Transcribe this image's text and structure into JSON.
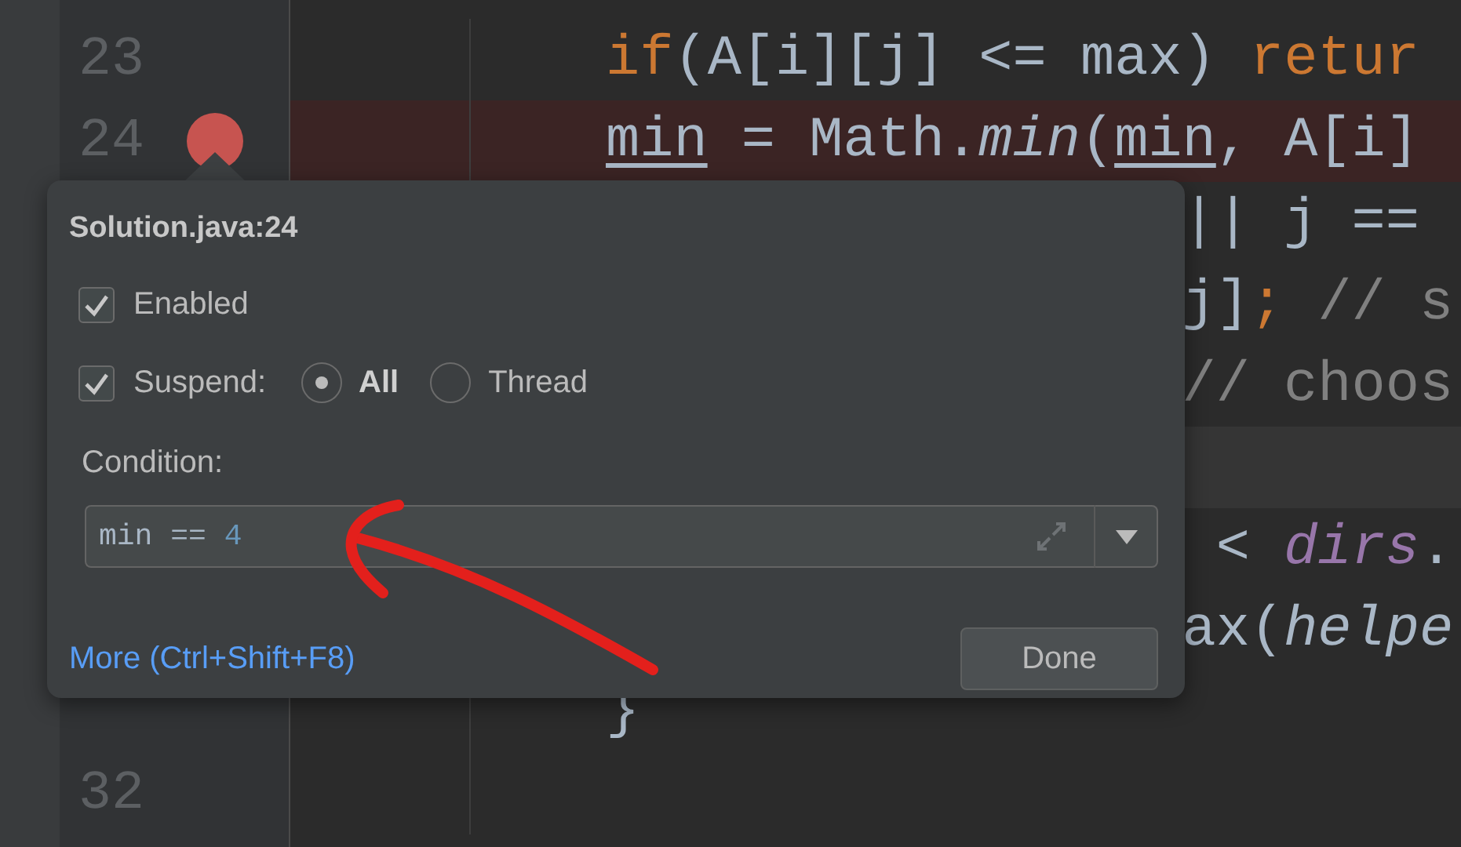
{
  "editor": {
    "lines": [
      {
        "number": "23",
        "breakpoint": false,
        "kind": "full",
        "tokens": [
          {
            "kind": "keyword",
            "text": "if"
          },
          {
            "kind": "plain",
            "text": "(A[i][j] <= max) "
          },
          {
            "kind": "keyword",
            "text": "retur"
          }
        ]
      },
      {
        "number": "24",
        "breakpoint": true,
        "kind": "full",
        "tokens": [
          {
            "kind": "reassigned",
            "text": "min"
          },
          {
            "kind": "plain",
            "text": " = Math."
          },
          {
            "kind": "method",
            "text": "min"
          },
          {
            "kind": "plain",
            "text": "("
          },
          {
            "kind": "reassigned",
            "text": "min"
          },
          {
            "kind": "plain",
            "text": ", A[i]"
          }
        ]
      },
      {
        "breakpoint": false,
        "kind": "behind_popup",
        "tokens": [
          {
            "kind": "plain",
            "text": "|| j =="
          }
        ]
      },
      {
        "breakpoint": false,
        "kind": "behind_popup",
        "tokens": [
          {
            "kind": "plain",
            "text": "j]"
          },
          {
            "kind": "keyword",
            "text": ";"
          },
          {
            "kind": "comment",
            "text": " // s"
          }
        ]
      },
      {
        "breakpoint": false,
        "kind": "behind_popup",
        "tokens": [
          {
            "kind": "comment",
            "text": "// choos"
          }
        ]
      },
      {
        "breakpoint": false,
        "current": true,
        "kind": "behind_popup"
      },
      {
        "breakpoint": false,
        "kind": "behind_popup",
        "tokens": [
          {
            "kind": "plain",
            "text": " < "
          },
          {
            "kind": "field",
            "text": "dirs"
          },
          {
            "kind": "plain",
            "text": "."
          }
        ]
      },
      {
        "breakpoint": false,
        "kind": "behind_popup",
        "tokens": [
          {
            "kind": "plain",
            "text": "ax("
          },
          {
            "kind": "method",
            "text": "helpe"
          }
        ]
      },
      {
        "breakpoint": false,
        "kind": "full",
        "tokens": [
          {
            "kind": "plain",
            "text": "}"
          }
        ]
      },
      {
        "number": "32",
        "breakpoint": false,
        "kind": "full"
      }
    ]
  },
  "breakpoint_popup": {
    "title": "Solution.java:24",
    "enabled": {
      "label": "Enabled",
      "checked": true
    },
    "suspend": {
      "label": "Suspend:",
      "checked": true,
      "choices": [
        {
          "label": "All",
          "selected": true
        },
        {
          "label": "Thread",
          "selected": false
        }
      ]
    },
    "condition": {
      "label": "Condition:",
      "tokens": [
        {
          "kind": "plain",
          "text": "min == "
        },
        {
          "kind": "number",
          "text": "4"
        }
      ]
    },
    "link": "More (Ctrl+Shift+F8)",
    "button": "Done"
  }
}
